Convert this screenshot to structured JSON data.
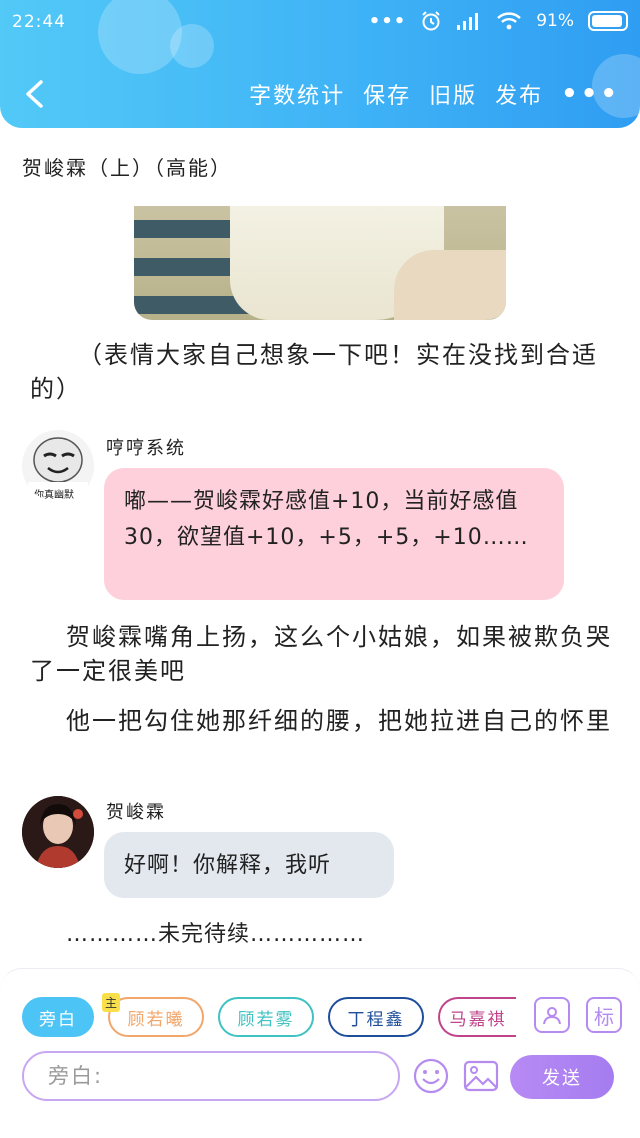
{
  "status_bar": {
    "time": "22:44",
    "battery": "91%",
    "dots": "•••"
  },
  "nav": {
    "actions": [
      "字数统计",
      "保存",
      "旧版",
      "发布"
    ],
    "more_label": "•••"
  },
  "story": {
    "title": "贺峻霖（上）（高能）",
    "paragraphs": {
      "p1": "（表情大家自己想象一下吧！实在没找到合适的）",
      "p2": "贺峻霖嘴角上扬，这么个小姑娘，如果被欺负哭了一定很美吧",
      "p3": "他一把勾住她那纤细的腰，把她拉进自己的怀里",
      "ending": "…………未完待续……………"
    },
    "chats": [
      {
        "speaker": "哼哼系统",
        "avatar_caption": "你真幽默",
        "text": "嘟——贺峻霖好感值+10，当前好感值30，欲望值+10，+5，+5，+10……",
        "bubble_color": "#fdd0dc"
      },
      {
        "speaker": "贺峻霖",
        "text": "好啊！你解释，我听",
        "bubble_color": "#e3e8ef"
      }
    ]
  },
  "bottom": {
    "roles": [
      {
        "label": "旁白",
        "color": "#4cc4f5",
        "active": true
      },
      {
        "label": "顾若曦",
        "color": "#f2a66a",
        "tag": "主"
      },
      {
        "label": "顾若雾",
        "color": "#3fc2c2"
      },
      {
        "label": "丁程鑫",
        "color": "#1f4f9b"
      },
      {
        "label": "马嘉祺",
        "color": "#c0448a"
      }
    ],
    "tag_color": "#f9e04b",
    "icon_user": "user-card-icon",
    "icon_tag": "标",
    "input_placeholder": "旁白:",
    "emoji_icon": "smiley-icon",
    "image_icon": "image-icon",
    "send_label": "发送"
  }
}
